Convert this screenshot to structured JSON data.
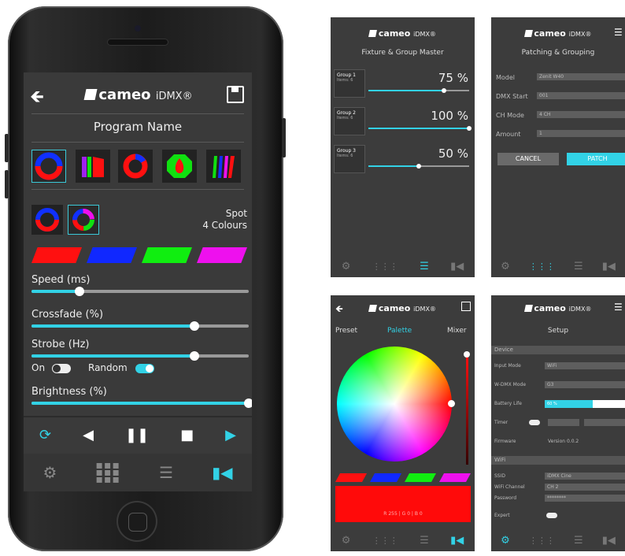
{
  "brand": {
    "logo": "cameo",
    "sub": "iDMX®",
    "accent": "#32d2e6"
  },
  "main": {
    "program_name": "Program Name",
    "preset_info": [
      "Spot",
      "4 Colours"
    ],
    "swatch_colors": [
      "#ff1010",
      "#1028ff",
      "#10ee10",
      "#ee10ee"
    ],
    "sliders": [
      {
        "label": "Speed (ms)",
        "value_text": "25",
        "level": 0.22
      },
      {
        "label": "Crossfade (%)",
        "value_text": "75",
        "level": 0.75
      },
      {
        "label": "Strobe (Hz)",
        "value_text": "75",
        "level": 0.75
      },
      {
        "label": "Brightness (%)",
        "value_text": "100",
        "level": 1.0
      }
    ],
    "toggles": [
      {
        "label": "On",
        "on": false
      },
      {
        "label": "Random",
        "on": true
      }
    ],
    "transport": [
      "loop-icon",
      "prev-icon",
      "pause-icon",
      "stop-icon",
      "play-icon"
    ],
    "nav": [
      "gear-icon",
      "grid-icon",
      "sliders-icon",
      "spotlight-icon"
    ]
  },
  "fixture_master": {
    "title": "Fixture & Group Master",
    "groups": [
      {
        "name": "Group 1",
        "sub": "Items: 6",
        "value_text": "75 %",
        "level": 0.75
      },
      {
        "name": "Group 2",
        "sub": "Items: 6",
        "value_text": "100 %",
        "level": 1.0
      },
      {
        "name": "Group 3",
        "sub": "Items: 6",
        "value_text": "50 %",
        "level": 0.5
      }
    ]
  },
  "patching": {
    "title": "Patching & Grouping",
    "rows": [
      {
        "label": "Model",
        "value": "Zenit W40"
      },
      {
        "label": "DMX Start",
        "value": "001"
      },
      {
        "label": "CH Mode",
        "value": "4 CH"
      },
      {
        "label": "Amount",
        "value": "1"
      }
    ],
    "cancel": "CANCEL",
    "patch": "PATCH"
  },
  "palette": {
    "tabs": [
      "Preset",
      "Palette",
      "Mixer"
    ],
    "active_tab": "Palette",
    "swatch_colors": [
      "#ff1010",
      "#1028ff",
      "#10ee10",
      "#ee10ee"
    ],
    "preview_color": "#ff0a0a",
    "rgb_readout": "R 255 | G 0 | B 0"
  },
  "setup": {
    "title": "Setup",
    "section_device": "Device",
    "rows": [
      {
        "label": "Input Mode",
        "value": "WiFi"
      },
      {
        "label": "W-DMX Mode",
        "value": "G3"
      },
      {
        "label": "Battery Life",
        "value": "60 %"
      },
      {
        "label": "Timer",
        "value": ""
      },
      {
        "label": "Firmware",
        "value": "Version 0.0.2"
      }
    ],
    "section_wifi": "WiFi",
    "wifi_rows": [
      {
        "label": "SSID",
        "value": "iDMX Cine"
      },
      {
        "label": "WiFi Channel",
        "value": "CH 2"
      },
      {
        "label": "Password",
        "value": "********"
      },
      {
        "label": "Expert",
        "value": ""
      }
    ]
  }
}
